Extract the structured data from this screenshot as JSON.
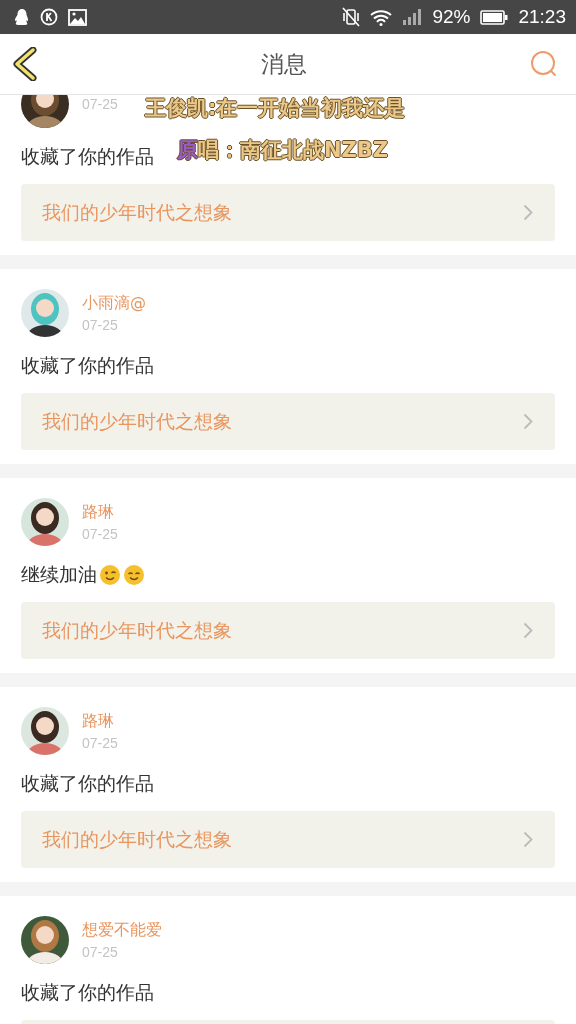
{
  "status_bar": {
    "battery": "92%",
    "time": "21:23"
  },
  "header": {
    "title": "消息"
  },
  "lyrics": [
    {
      "text": "王俊凯:在一开始当初我还是"
    },
    {
      "sung": "原",
      "text": "唱：南征北战NZBZ"
    }
  ],
  "messages": [
    {
      "date": "07-25",
      "text": "收藏了你的作品",
      "work": "我们的少年时代之想象"
    },
    {
      "name": "小雨滴@",
      "date": "07-25",
      "text": "收藏了你的作品",
      "work": "我们的少年时代之想象"
    },
    {
      "name": "路琳",
      "date": "07-25",
      "text": "继续加油",
      "emoji": [
        {
          "kind": "wink"
        },
        {
          "kind": "smile"
        }
      ],
      "work": "我们的少年时代之想象"
    },
    {
      "name": "路琳",
      "date": "07-25",
      "text": "收藏了你的作品",
      "work": "我们的少年时代之想象"
    },
    {
      "name": "想爱不能爱",
      "date": "07-25",
      "text": "收藏了你的作品"
    }
  ]
}
